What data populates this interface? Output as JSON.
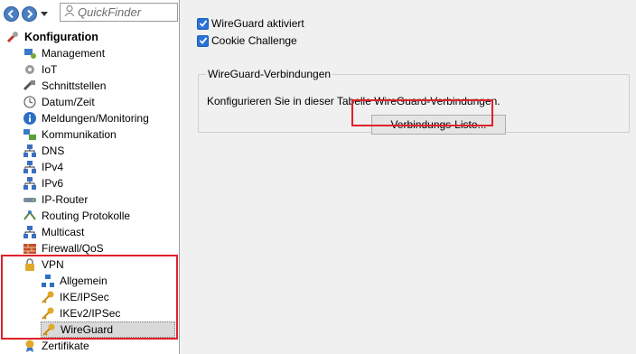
{
  "toolbar": {
    "quickfinder_placeholder": "QuickFinder"
  },
  "tree": {
    "root_label": "Konfiguration",
    "items": [
      {
        "label": "Management",
        "icon": "management-icon"
      },
      {
        "label": "IoT",
        "icon": "iot-icon"
      },
      {
        "label": "Schnittstellen",
        "icon": "interfaces-icon"
      },
      {
        "label": "Datum/Zeit",
        "icon": "clock-icon"
      },
      {
        "label": "Meldungen/Monitoring",
        "icon": "info-icon"
      },
      {
        "label": "Kommunikation",
        "icon": "communication-icon"
      },
      {
        "label": "DNS",
        "icon": "network-icon"
      },
      {
        "label": "IPv4",
        "icon": "network-icon"
      },
      {
        "label": "IPv6",
        "icon": "network-icon"
      },
      {
        "label": "IP-Router",
        "icon": "router-icon"
      },
      {
        "label": "Routing Protokolle",
        "icon": "routing-icon"
      },
      {
        "label": "Multicast",
        "icon": "network-icon"
      },
      {
        "label": "Firewall/QoS",
        "icon": "firewall-icon"
      },
      {
        "label": "VPN",
        "icon": "lock-icon"
      },
      {
        "label": "Allgemein",
        "icon": "general-icon"
      },
      {
        "label": "IKE/IPSec",
        "icon": "key-icon"
      },
      {
        "label": "IKEv2/IPSec",
        "icon": "key-icon"
      },
      {
        "label": "WireGuard",
        "icon": "key-icon"
      },
      {
        "label": "Zertifikate",
        "icon": "certificate-icon"
      }
    ]
  },
  "settings": {
    "wireguard_enabled": {
      "label": "WireGuard aktiviert",
      "checked": true
    },
    "cookie_challenge": {
      "label": "Cookie Challenge",
      "checked": true
    },
    "group": {
      "title": "WireGuard-Verbindungen",
      "description": "Konfigurieren Sie in dieser Tabelle WireGuard-Verbindungen.",
      "button_label": "Verbindungs-Liste..."
    }
  },
  "colors": {
    "highlight": "#e0202a",
    "checkbox": "#2a72d6",
    "selected_row": "#d9d9d9"
  }
}
